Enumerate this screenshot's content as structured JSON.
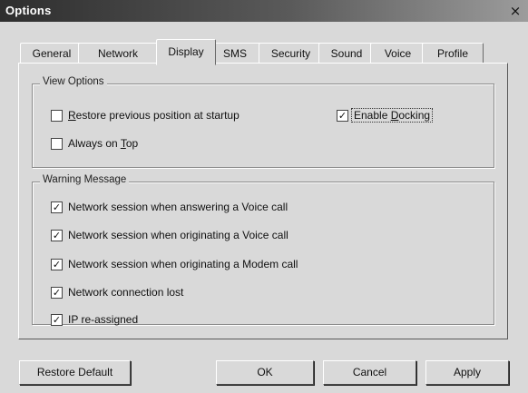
{
  "window": {
    "title": "Options"
  },
  "tabs": [
    {
      "label": "General"
    },
    {
      "label": "Network"
    },
    {
      "label": "Display",
      "active": true
    },
    {
      "label": "SMS"
    },
    {
      "label": "Security"
    },
    {
      "label": "Sound"
    },
    {
      "label": "Voice"
    },
    {
      "label": "Profile"
    }
  ],
  "view_options": {
    "title": "View Options",
    "restore_position": {
      "pre": "",
      "mnemonic": "R",
      "post": "estore previous position at startup",
      "checked": false
    },
    "always_on_top": {
      "pre": "Always on ",
      "mnemonic": "T",
      "post": "op",
      "checked": false
    },
    "enable_docking": {
      "pre": "Enable ",
      "mnemonic": "D",
      "post": "ocking",
      "checked": true
    }
  },
  "warning_message": {
    "title": "Warning Message",
    "items": [
      {
        "label": "Network session when answering a Voice call",
        "checked": true
      },
      {
        "label": "Network session when originating a Voice call",
        "checked": true
      },
      {
        "label": "Network session when originating a Modem call",
        "checked": true
      },
      {
        "label": "Network connection lost",
        "checked": true
      },
      {
        "label": "IP re-assigned",
        "checked": true
      }
    ]
  },
  "buttons": {
    "restore_default": "Restore Default",
    "ok": "OK",
    "cancel": "Cancel",
    "apply": "Apply"
  },
  "icons": {
    "close": "close-icon",
    "check": "checkmark-icon"
  },
  "symbols": {
    "close": "×",
    "check": "✓"
  }
}
